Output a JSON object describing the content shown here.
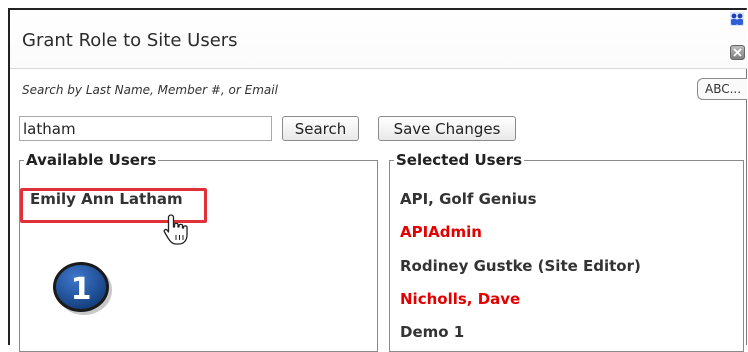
{
  "dialog": {
    "title": "Grant Role to Site Users"
  },
  "search": {
    "hint": "Search by Last Name, Member #, or Email",
    "value": "latham",
    "search_label": "Search",
    "save_label": "Save Changes",
    "abc_label": "ABC..."
  },
  "available": {
    "legend": "Available Users",
    "items": [
      {
        "name": "Emily Ann Latham"
      }
    ]
  },
  "selected": {
    "legend": "Selected Users",
    "items": [
      {
        "name": "API, Golf Genius",
        "status": "normal"
      },
      {
        "name": "APIAdmin",
        "status": "admin"
      },
      {
        "name": "Rodiney Gustke (Site Editor)",
        "status": "normal"
      },
      {
        "name": "Nicholls, Dave",
        "status": "admin"
      },
      {
        "name": "Demo 1",
        "status": "normal"
      }
    ]
  },
  "annotation": {
    "step_number": "1",
    "highlight_color": "#e0303a",
    "badge_color": "#1e4f9e"
  },
  "colors": {
    "normal_user": "#333333",
    "admin_user": "#e30000"
  },
  "icons": {
    "top_right": "user-group-icon",
    "close": "close-icon",
    "pointer": "hand-pointer-icon"
  }
}
